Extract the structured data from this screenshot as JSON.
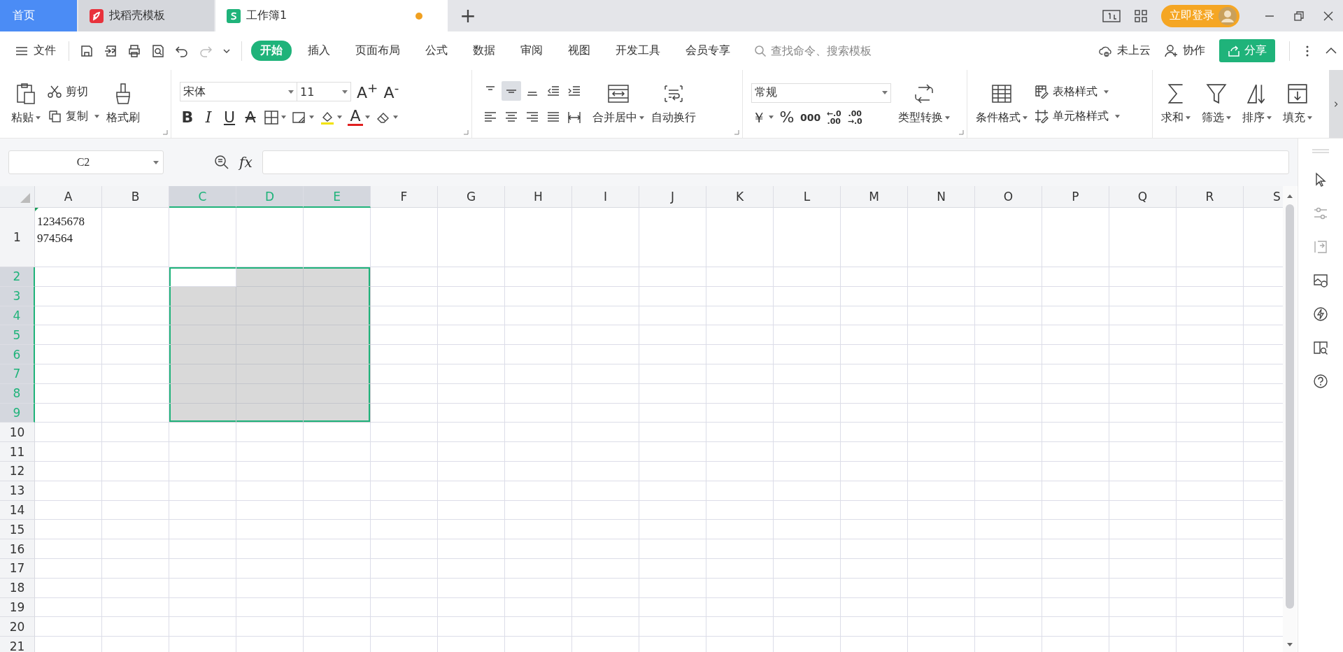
{
  "tabs": [
    {
      "label": "首页",
      "kind": "home",
      "selected": false,
      "unsaved": false
    },
    {
      "label": "找稻壳模板",
      "kind": "docer",
      "selected": false,
      "unsaved": false
    },
    {
      "label": "工作簿1",
      "kind": "sheet",
      "selected": true,
      "unsaved": true
    }
  ],
  "add_tab": "+",
  "login_button": "立即登录",
  "file_menu": "文件",
  "ribbon_tabs": [
    {
      "label": "开始",
      "selected": true
    },
    {
      "label": "插入",
      "selected": false
    },
    {
      "label": "页面布局",
      "selected": false
    },
    {
      "label": "公式",
      "selected": false
    },
    {
      "label": "数据",
      "selected": false
    },
    {
      "label": "审阅",
      "selected": false
    },
    {
      "label": "视图",
      "selected": false
    },
    {
      "label": "开发工具",
      "selected": false
    },
    {
      "label": "会员专享",
      "selected": false
    }
  ],
  "search": {
    "placeholder": "查找命令、搜索模板"
  },
  "cloud": "未上云",
  "collaborate": "协作",
  "share": "分享",
  "ribbon": {
    "paste": "粘贴",
    "cut": "剪切",
    "copy": "复制",
    "format_painter": "格式刷",
    "font_name": "宋体",
    "font_size": "11",
    "grow_font": "A$^{+}$",
    "shrink_font": "A$^{-}$",
    "bold": "B",
    "italic": "I",
    "underline": "U",
    "strike": "A",
    "font_color": "A",
    "merge": "合并居中",
    "wrap": "自动换行",
    "number_format": "常规",
    "currency": "￥",
    "percent": "%",
    "thousands": "000",
    "decimal_increase": [
      "←.0",
      ".00"
    ],
    "decimal_decrease": [
      ".00",
      "→.0"
    ],
    "convert": "类型转换",
    "conditional": "条件格式",
    "table_style": "表格样式",
    "cell_style": "单元格样式",
    "sum": "求和",
    "filter": "筛选",
    "sort": "排序",
    "fill": "填充"
  },
  "name_box": "C2",
  "fx": "fx",
  "sheet": {
    "columns": [
      {
        "label": "A",
        "selected": false
      },
      {
        "label": "B",
        "selected": false
      },
      {
        "label": "C",
        "selected": true
      },
      {
        "label": "D",
        "selected": true
      },
      {
        "label": "E",
        "selected": true
      },
      {
        "label": "F",
        "selected": false
      },
      {
        "label": "G",
        "selected": false
      },
      {
        "label": "H",
        "selected": false
      },
      {
        "label": "I",
        "selected": false
      },
      {
        "label": "J",
        "selected": false
      },
      {
        "label": "K",
        "selected": false
      },
      {
        "label": "L",
        "selected": false
      },
      {
        "label": "M",
        "selected": false
      },
      {
        "label": "N",
        "selected": false
      },
      {
        "label": "O",
        "selected": false
      },
      {
        "label": "P",
        "selected": false
      },
      {
        "label": "Q",
        "selected": false
      },
      {
        "label": "R",
        "selected": false
      },
      {
        "label": "S",
        "selected": false
      }
    ],
    "rows": [
      {
        "label": "1",
        "selected": false,
        "cells": [
          "12345678\n974564"
        ]
      },
      {
        "label": "2",
        "selected": true
      },
      {
        "label": "3",
        "selected": true
      },
      {
        "label": "4",
        "selected": true
      },
      {
        "label": "5",
        "selected": true
      },
      {
        "label": "6",
        "selected": true
      },
      {
        "label": "7",
        "selected": true
      },
      {
        "label": "8",
        "selected": true
      },
      {
        "label": "9",
        "selected": true
      },
      {
        "label": "10",
        "selected": false
      },
      {
        "label": "11",
        "selected": false
      },
      {
        "label": "12",
        "selected": false
      },
      {
        "label": "13",
        "selected": false
      },
      {
        "label": "14",
        "selected": false
      },
      {
        "label": "15",
        "selected": false
      },
      {
        "label": "16",
        "selected": false
      },
      {
        "label": "17",
        "selected": false
      },
      {
        "label": "18",
        "selected": false
      },
      {
        "label": "19",
        "selected": false
      },
      {
        "label": "20",
        "selected": false
      },
      {
        "label": "21",
        "selected": false
      }
    ]
  }
}
